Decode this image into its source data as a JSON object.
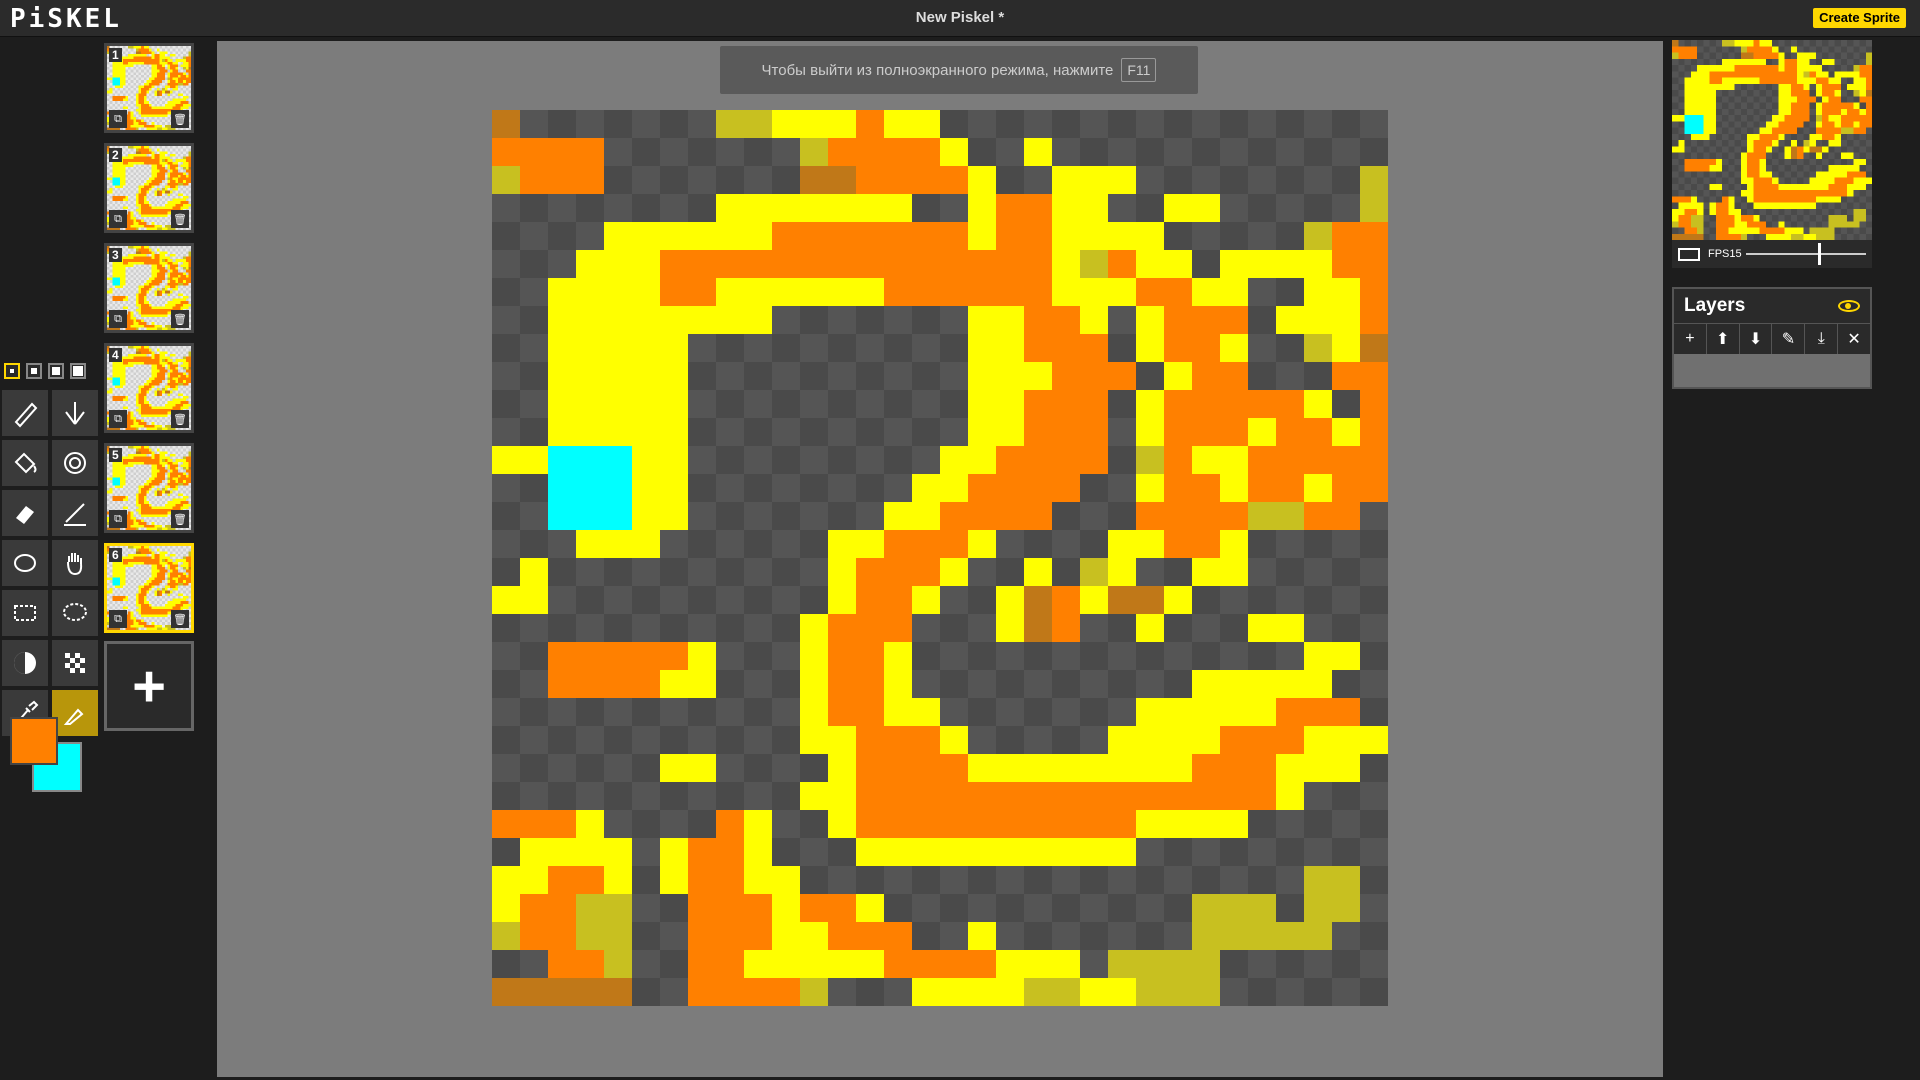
{
  "app": {
    "logo": "PiSKEL",
    "title": "New Piskel *",
    "create_button": "Create Sprite"
  },
  "fullscreen_hint": {
    "text": "Чтобы выйти из полноэкранного режима, нажмите",
    "key": "F11"
  },
  "frames": [
    {
      "number": "1",
      "active": false
    },
    {
      "number": "2",
      "active": false
    },
    {
      "number": "3",
      "active": false
    },
    {
      "number": "4",
      "active": false
    },
    {
      "number": "5",
      "active": false
    },
    {
      "number": "6",
      "active": true
    }
  ],
  "add_frame_label": "+",
  "tools": [
    {
      "name": "pen-tool-icon",
      "active": false
    },
    {
      "name": "mirror-pen-tool-icon",
      "active": false
    },
    {
      "name": "paint-bucket-tool-icon",
      "active": false
    },
    {
      "name": "paint-all-same-color-tool-icon",
      "active": false
    },
    {
      "name": "eraser-tool-icon",
      "active": false
    },
    {
      "name": "stroke-tool-icon",
      "active": false
    },
    {
      "name": "circle-tool-icon",
      "active": false
    },
    {
      "name": "move-hand-tool-icon",
      "active": false
    },
    {
      "name": "rectangle-select-tool-icon",
      "active": false
    },
    {
      "name": "lasso-select-tool-icon",
      "active": false
    },
    {
      "name": "lighten-tool-icon",
      "active": false
    },
    {
      "name": "dithering-tool-icon",
      "active": false
    },
    {
      "name": "color-picker-tool-icon",
      "active": false
    },
    {
      "name": "color-swap-tool-icon",
      "active": true
    }
  ],
  "colors": {
    "primary": "#ff8000",
    "secondary": "#00ffff",
    "accent": "#ffd700"
  },
  "preview": {
    "fps_label": "FPS15",
    "fps": 15
  },
  "layers": {
    "title": "Layers",
    "tools": [
      "+",
      "⬆",
      "⬇",
      "✎",
      "⤓",
      "✕"
    ]
  }
}
